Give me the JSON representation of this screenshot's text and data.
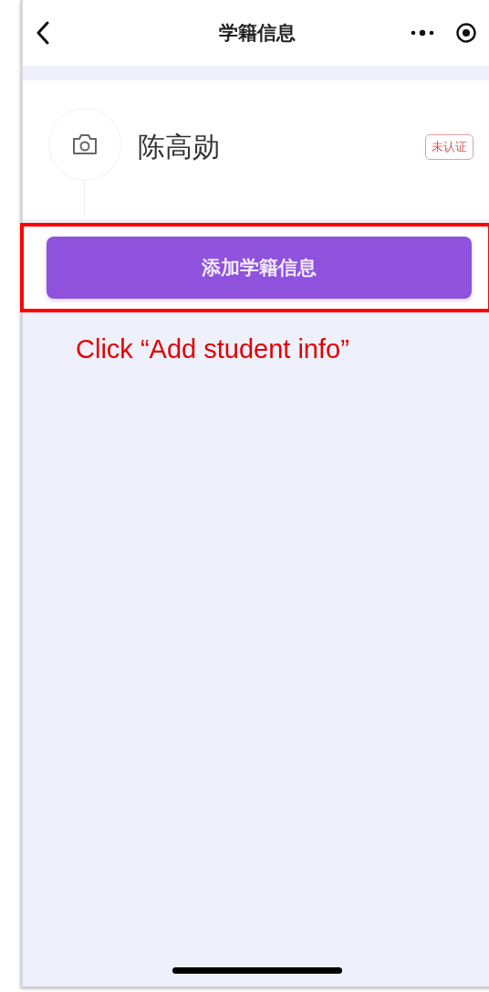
{
  "nav_bar": {
    "title": "学籍信息"
  },
  "profile": {
    "name": "陈高勋",
    "badge": "未认证"
  },
  "add_button": {
    "label": "添加学籍信息",
    "highlighted": true
  },
  "annotation": "Click “Add student info”"
}
